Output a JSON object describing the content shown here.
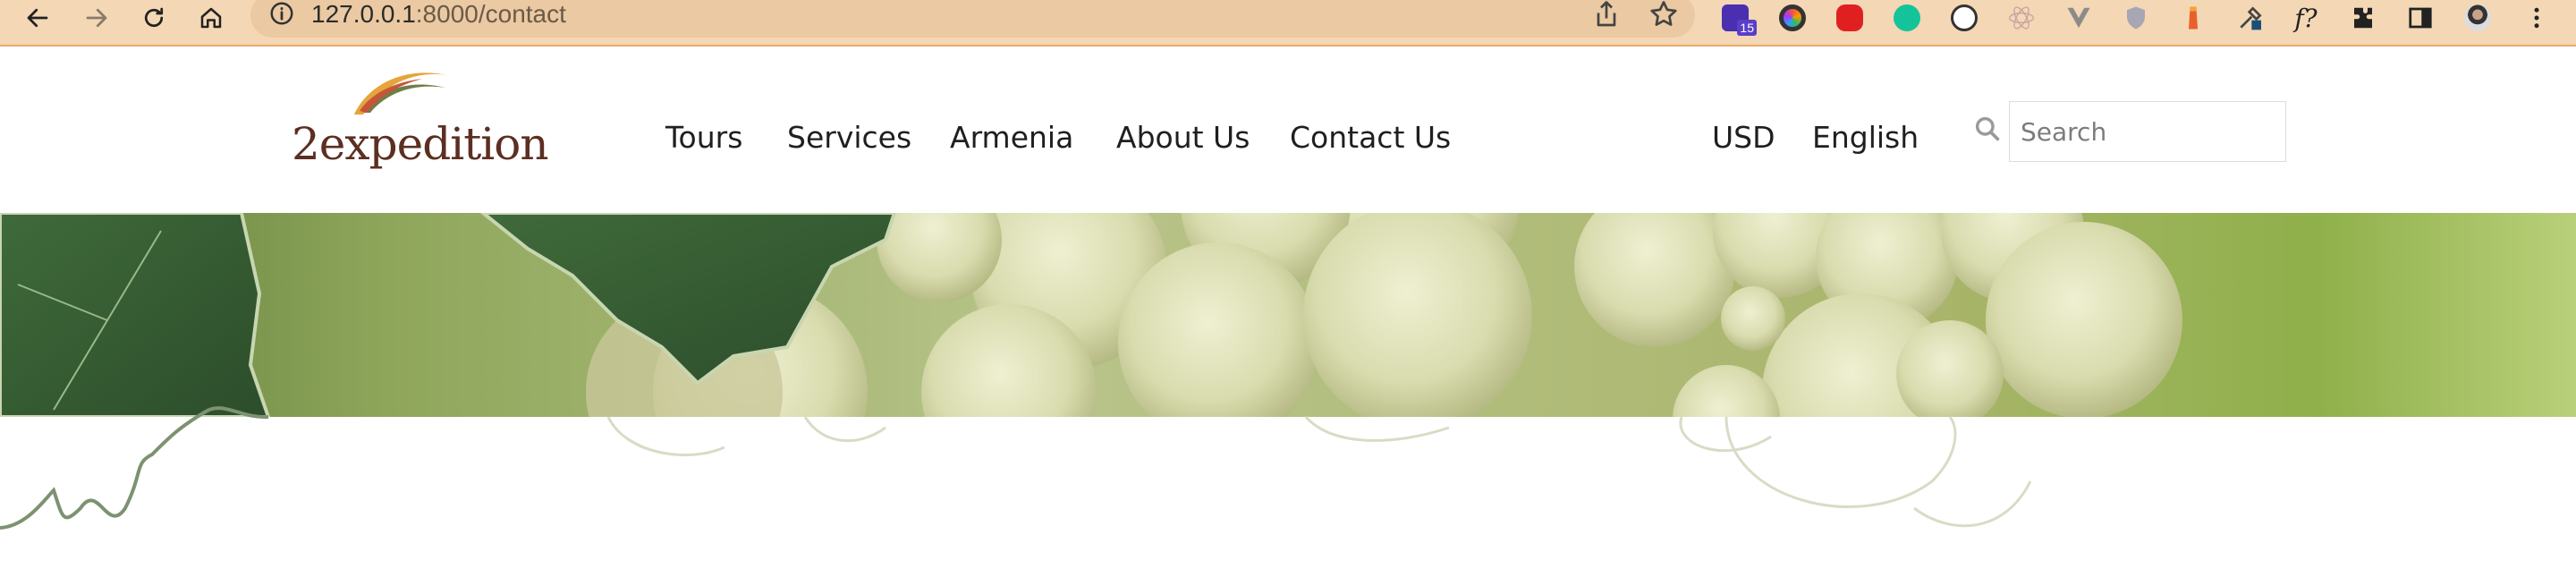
{
  "browser": {
    "url_host": "127.0.0.1",
    "url_rest": ":8000/contact",
    "extension_badge": "15",
    "extension_text": "f?"
  },
  "site": {
    "logo_text": "2expedition",
    "menu": [
      "Tours",
      "Services",
      "Armenia",
      "About Us",
      "Contact Us"
    ],
    "currency": "USD",
    "language": "English",
    "search_placeholder": "Search"
  },
  "colors": {
    "chrome": "#f4d7b4",
    "omnibox": "#ebc9a2",
    "logo_brown": "#5c2f22"
  }
}
